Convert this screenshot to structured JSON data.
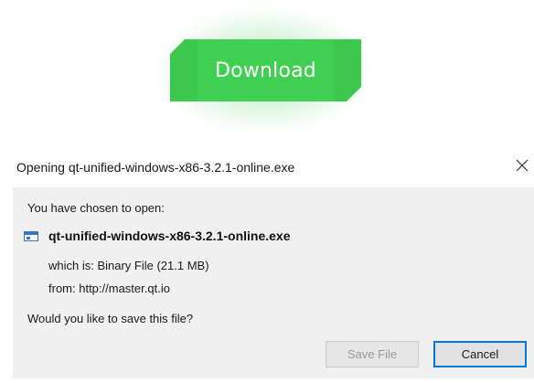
{
  "download_button": {
    "label": "Download"
  },
  "dialog": {
    "title": "Opening qt-unified-windows-x86-3.2.1-online.exe",
    "close_glyph": "×",
    "chosen_text": "You have chosen to open:",
    "file_name": "qt-unified-windows-x86-3.2.1-online.exe",
    "file_icon": "executable-file-icon",
    "which_is": "which is:  Binary File (21.1 MB)",
    "from": "from:  http://master.qt.io",
    "question": "Would you like to save this file?",
    "save_label": "Save File",
    "cancel_label": "Cancel"
  },
  "colors": {
    "download_green": "#3fd052",
    "dialog_bg": "#f0f0f0",
    "focus_blue": "#0078d7"
  }
}
